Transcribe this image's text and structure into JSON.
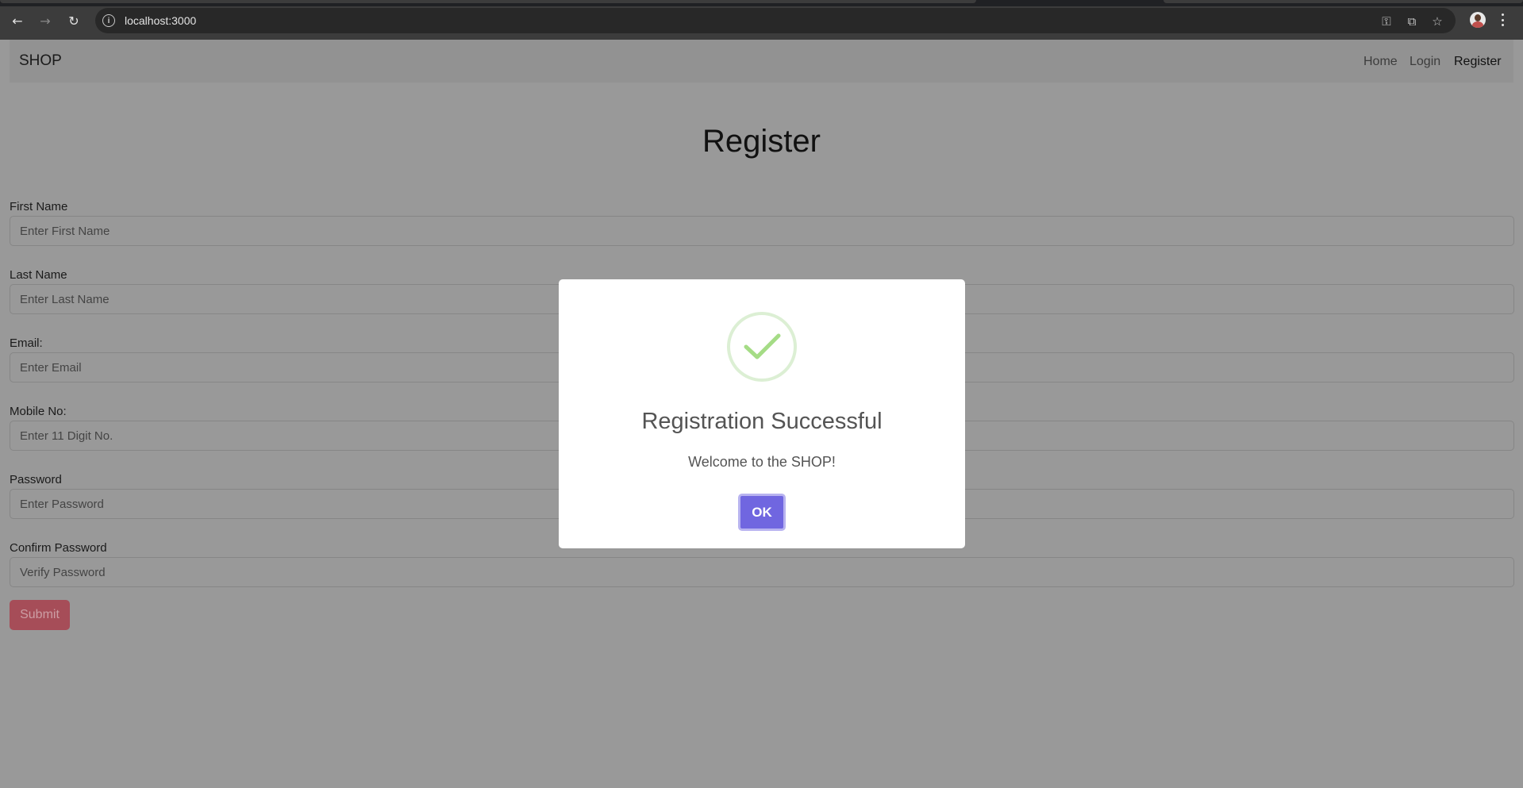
{
  "browser": {
    "url": "localhost:3000"
  },
  "navbar": {
    "brand": "SHOP",
    "links": [
      {
        "label": "Home"
      },
      {
        "label": "Login"
      },
      {
        "label": "Register"
      }
    ]
  },
  "page": {
    "title": "Register"
  },
  "form": {
    "fields": [
      {
        "label": "First Name",
        "placeholder": "Enter First Name",
        "value": ""
      },
      {
        "label": "Last Name",
        "placeholder": "Enter Last Name",
        "value": ""
      },
      {
        "label": "Email:",
        "placeholder": "Enter Email",
        "value": ""
      },
      {
        "label": "Mobile No:",
        "placeholder": "Enter 11 Digit No.",
        "value": ""
      },
      {
        "label": "Password",
        "placeholder": "Enter Password",
        "value": ""
      },
      {
        "label": "Confirm Password",
        "placeholder": "Verify Password",
        "value": ""
      }
    ],
    "submit_label": "Submit"
  },
  "modal": {
    "title": "Registration Successful",
    "text": "Welcome to the SHOP!",
    "ok_label": "OK",
    "icon": "success-check-icon",
    "accent_color": "#7066e0",
    "success_color": "#a5dc86"
  }
}
